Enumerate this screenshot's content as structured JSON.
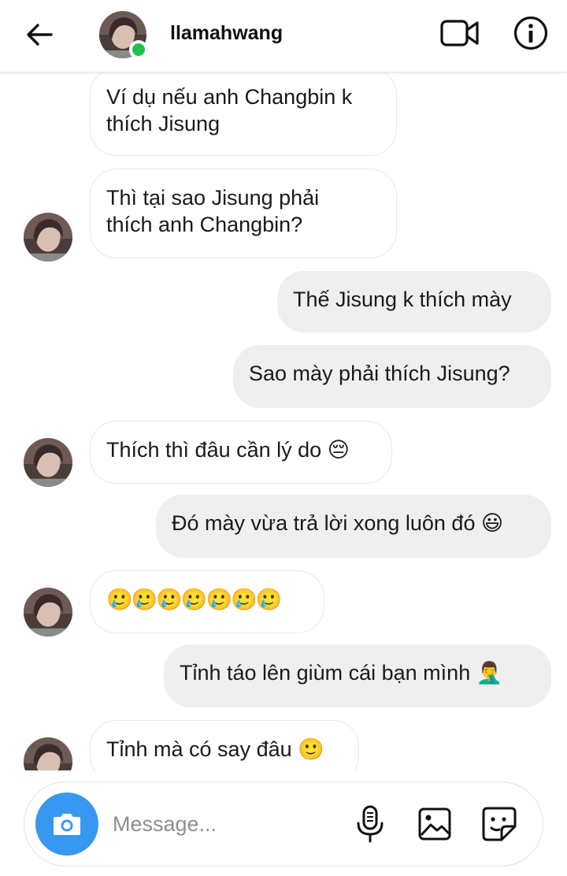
{
  "header": {
    "username": "llamahwang",
    "online": true,
    "icons": [
      "back-arrow-icon",
      "video-call-icon",
      "info-icon"
    ]
  },
  "messages": [
    {
      "side": "in",
      "show_avatar": false,
      "lines": [
        "Ví dụ nếu anh Changbin k",
        "thích Jisung"
      ]
    },
    {
      "side": "in",
      "show_avatar": true,
      "lines": [
        "Thì tại sao Jisung phải",
        "thích anh Changbin?"
      ]
    },
    {
      "side": "out",
      "lines": [
        "Thế Jisung k thích mày"
      ]
    },
    {
      "side": "out",
      "lines": [
        "Sao mày phải thích Jisung?"
      ]
    },
    {
      "side": "in",
      "show_avatar": true,
      "text": "Thích thì đâu cần lý do",
      "emoji": "😔"
    },
    {
      "side": "out",
      "text": "Đó mày vừa trả lời xong luôn đó",
      "emoji": "😃"
    },
    {
      "side": "in",
      "show_avatar": true,
      "emoji_only": "🥲🥲🥲🥲🥲🥲🥲"
    },
    {
      "side": "out",
      "text": "Tỉnh táo lên giùm cái bạn mình",
      "emoji": "🤦‍♂️"
    },
    {
      "side": "in",
      "show_avatar": true,
      "text": "Tỉnh mà có say đâu",
      "emoji": "🙂"
    }
  ],
  "composer": {
    "placeholder": "Message...",
    "icons": [
      "camera-icon",
      "microphone-icon",
      "gallery-icon",
      "sticker-icon"
    ]
  },
  "colors": {
    "accent_blue": "#3897f0",
    "online_green": "#21c04a",
    "outgoing_bubble": "#efefef",
    "incoming_border": "#e8e8e8"
  }
}
